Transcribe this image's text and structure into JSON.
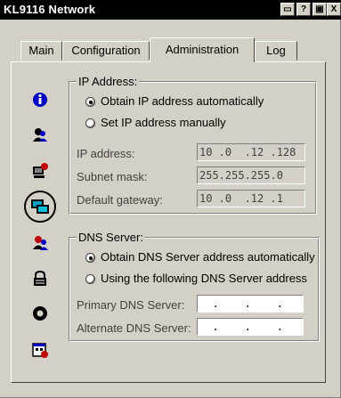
{
  "window": {
    "title": "KL9116 Network"
  },
  "titlebar_buttons": {
    "minimize": "▭",
    "help": "?",
    "maximize": "▣",
    "close": "X"
  },
  "tabs": [
    {
      "label": "Main"
    },
    {
      "label": "Configuration"
    },
    {
      "label": "Administration",
      "active": true
    },
    {
      "label": "Log"
    }
  ],
  "sidebar_icons": [
    "info-icon",
    "user-icon",
    "device-icon",
    "network-icon",
    "user-security-icon",
    "lock-icon",
    "gear-icon",
    "calendar-icon"
  ],
  "ip": {
    "legend": "IP Address:",
    "auto_label": "Obtain IP address automatically",
    "manual_label": "Set IP address manually",
    "selected": "auto",
    "address_label": "IP address:",
    "address_value": "10 .0  .12 .128",
    "mask_label": "Subnet mask:",
    "mask_value": "255.255.255.0",
    "gateway_label": "Default gateway:",
    "gateway_value": "10 .0  .12 .1"
  },
  "dns": {
    "legend": "DNS Server:",
    "auto_label": "Obtain DNS Server address automatically",
    "manual_label": "Using the following DNS Server address",
    "selected": "auto",
    "primary_label": "Primary DNS Server:",
    "primary_value": "  .    .    .   ",
    "alternate_label": "Alternate DNS Server:",
    "alternate_value": "  .    .    .   "
  },
  "colors": {
    "accent_blue": "#0000c0",
    "accent_red": "#c00000",
    "titlebar": "#000000",
    "face": "#d4d0c8"
  }
}
